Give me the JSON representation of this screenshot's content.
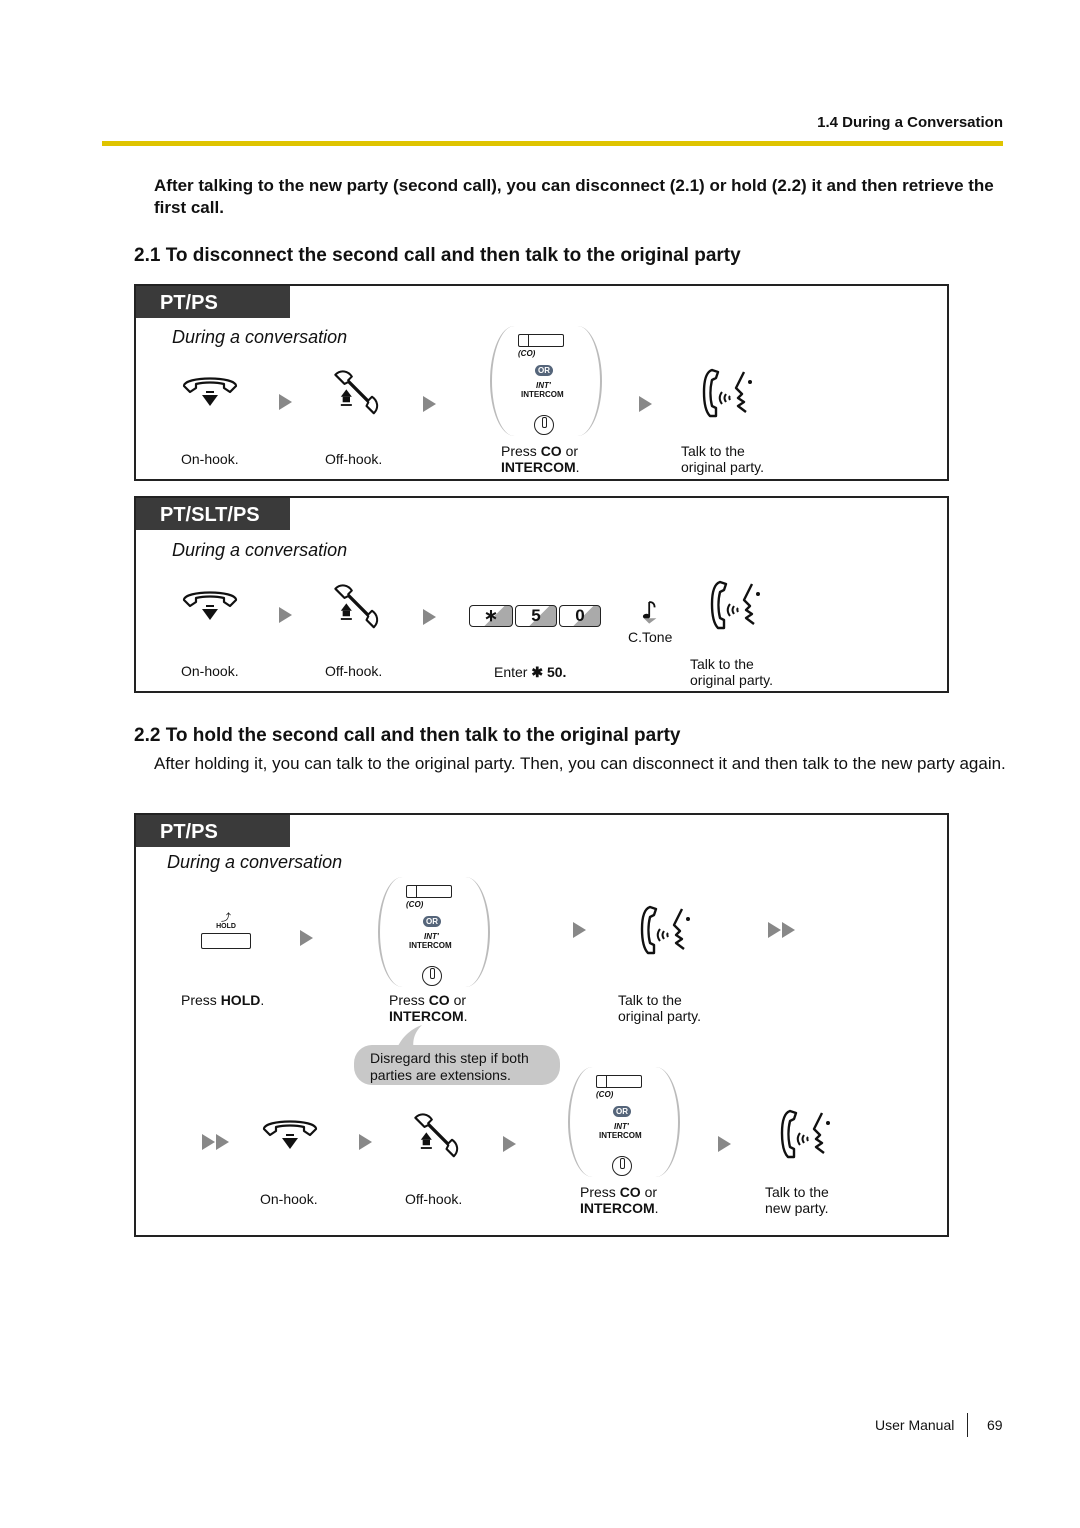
{
  "header": {
    "section_title": "1.4 During a Conversation",
    "rule_color": "#dfc400"
  },
  "intro": "After talking to the new party (second call), you can disconnect (2.1) or hold (2.2) it and then retrieve the first call.",
  "section_2_1": {
    "heading": "2.1 To disconnect the second call and then talk to the original party",
    "box_pt_ps": {
      "tag": "PT/PS",
      "context": "During a conversation",
      "steps": [
        {
          "icon": "on-hook-icon",
          "caption": "On-hook."
        },
        {
          "icon": "off-hook-icon",
          "caption": "Off-hook."
        },
        {
          "icon": "co-or-intercom-icon",
          "caption_pre": "Press ",
          "caption_bold": "CO",
          "caption_mid": " or",
          "caption_bold2": "INTERCOM",
          "caption_post": "."
        },
        {
          "icon": "talk-icon",
          "caption_line1": "Talk to the",
          "caption_line2": "original party."
        }
      ]
    },
    "box_pt_slt_ps": {
      "tag": "PT/SLT/PS",
      "context": "During a conversation",
      "keys": [
        "∗",
        "5",
        "0"
      ],
      "tone_label": "C.Tone",
      "steps": [
        {
          "icon": "on-hook-icon",
          "caption": "On-hook."
        },
        {
          "icon": "off-hook-icon",
          "caption": "Off-hook."
        },
        {
          "icon": "dial-keys-icon",
          "caption_pre": "Enter ",
          "caption_bold": "✱ 50."
        },
        {
          "icon": "talk-icon",
          "caption_line1": "Talk to the",
          "caption_line2": "original party."
        }
      ]
    }
  },
  "section_2_2": {
    "heading": "2.2 To hold the second call and then talk to the original party",
    "description": "After holding it, you can talk to the original party. Then, you can disconnect it and then talk to the new party again.",
    "box": {
      "tag": "PT/PS",
      "context": "During a conversation",
      "hold_key_label": "HOLD",
      "row1": [
        {
          "icon": "hold-button-icon",
          "caption_pre": "Press ",
          "caption_bold": "HOLD",
          "caption_post": "."
        },
        {
          "icon": "co-or-intercom-icon",
          "caption_pre": "Press ",
          "caption_bold": "CO",
          "caption_mid": " or",
          "caption_bold2": "INTERCOM",
          "caption_post": "."
        },
        {
          "icon": "talk-icon",
          "caption_line1": "Talk to the",
          "caption_line2": "original party."
        }
      ],
      "note": "Disregard this step if both parties are extensions.",
      "row2": [
        {
          "icon": "on-hook-icon",
          "caption": "On-hook."
        },
        {
          "icon": "off-hook-icon",
          "caption": "Off-hook."
        },
        {
          "icon": "co-or-intercom-icon",
          "caption_pre": "Press ",
          "caption_bold": "CO",
          "caption_mid": " or",
          "caption_bold2": "INTERCOM",
          "caption_post": "."
        },
        {
          "icon": "talk-icon",
          "caption_line1": "Talk to the",
          "caption_line2": "new party."
        }
      ]
    }
  },
  "co_block": {
    "co_label": "(CO)",
    "or_label": "OR",
    "int_label": "INT'",
    "intercom_label": "INTERCOM"
  },
  "footer": {
    "label": "User Manual",
    "page": "69"
  }
}
